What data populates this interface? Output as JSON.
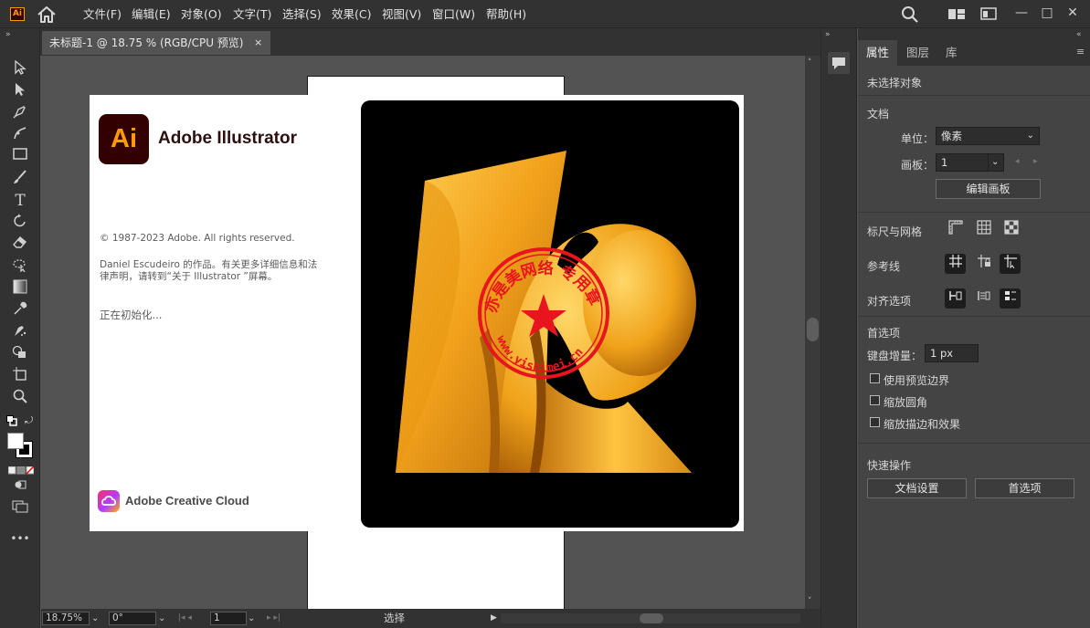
{
  "menu": {
    "app_icon": "Ai",
    "items": [
      "文件(F)",
      "编辑(E)",
      "对象(O)",
      "文字(T)",
      "选择(S)",
      "效果(C)",
      "视图(V)",
      "窗口(W)",
      "帮助(H)"
    ]
  },
  "window": {
    "minimize": "—",
    "maximize": "□",
    "close": "✕"
  },
  "document_tab": {
    "label": "未标题-1 @ 18.75 % (RGB/CPU 预览)",
    "close": "×"
  },
  "splash": {
    "logo_text": "Ai",
    "product_name": "Adobe Illustrator",
    "copyright": "© 1987-2023 Adobe. All rights reserved.",
    "credits": "Daniel  Escudeiro 的作品。有关更多详细信息和法律声明，请转到“关于  Illustrator ”屏幕。",
    "status": "正在初始化...",
    "cloud_label": "Adobe Creative Cloud",
    "watermark_text": "亦是美网络  专用章",
    "watermark_url": "www.yishimei.cn"
  },
  "status_bar": {
    "zoom": "18.75%",
    "rotation": "0°",
    "artboard_number": "1",
    "tool": "选择"
  },
  "panel": {
    "tabs": [
      "属性",
      "图层",
      "库"
    ],
    "active_tab": "属性",
    "no_selection": "未选择对象",
    "document_section": "文档",
    "units_label": "单位：",
    "units_value": "像素",
    "artboard_label": "画板：",
    "artboard_value": "1",
    "edit_artboards": "编辑画板",
    "rulers_grids": "标尺与网格",
    "guides": "参考线",
    "align_options": "对齐选项",
    "preferences": "首选项",
    "keyboard_increment_label": "键盘增量：",
    "keyboard_increment_value": "1 px",
    "checkboxes": [
      "使用预览边界",
      "缩放圆角",
      "缩放描边和效果"
    ],
    "quick_actions": "快速操作",
    "doc_setup_button": "文档设置",
    "preferences_button": "首选项"
  },
  "colors": {
    "ai_brand": "#ff9a00",
    "ai_bg": "#330000",
    "ui_dark": "#323232",
    "panel_bg": "#444444",
    "art_orange": "#f3a51f",
    "stamp_red": "#e8141e"
  }
}
